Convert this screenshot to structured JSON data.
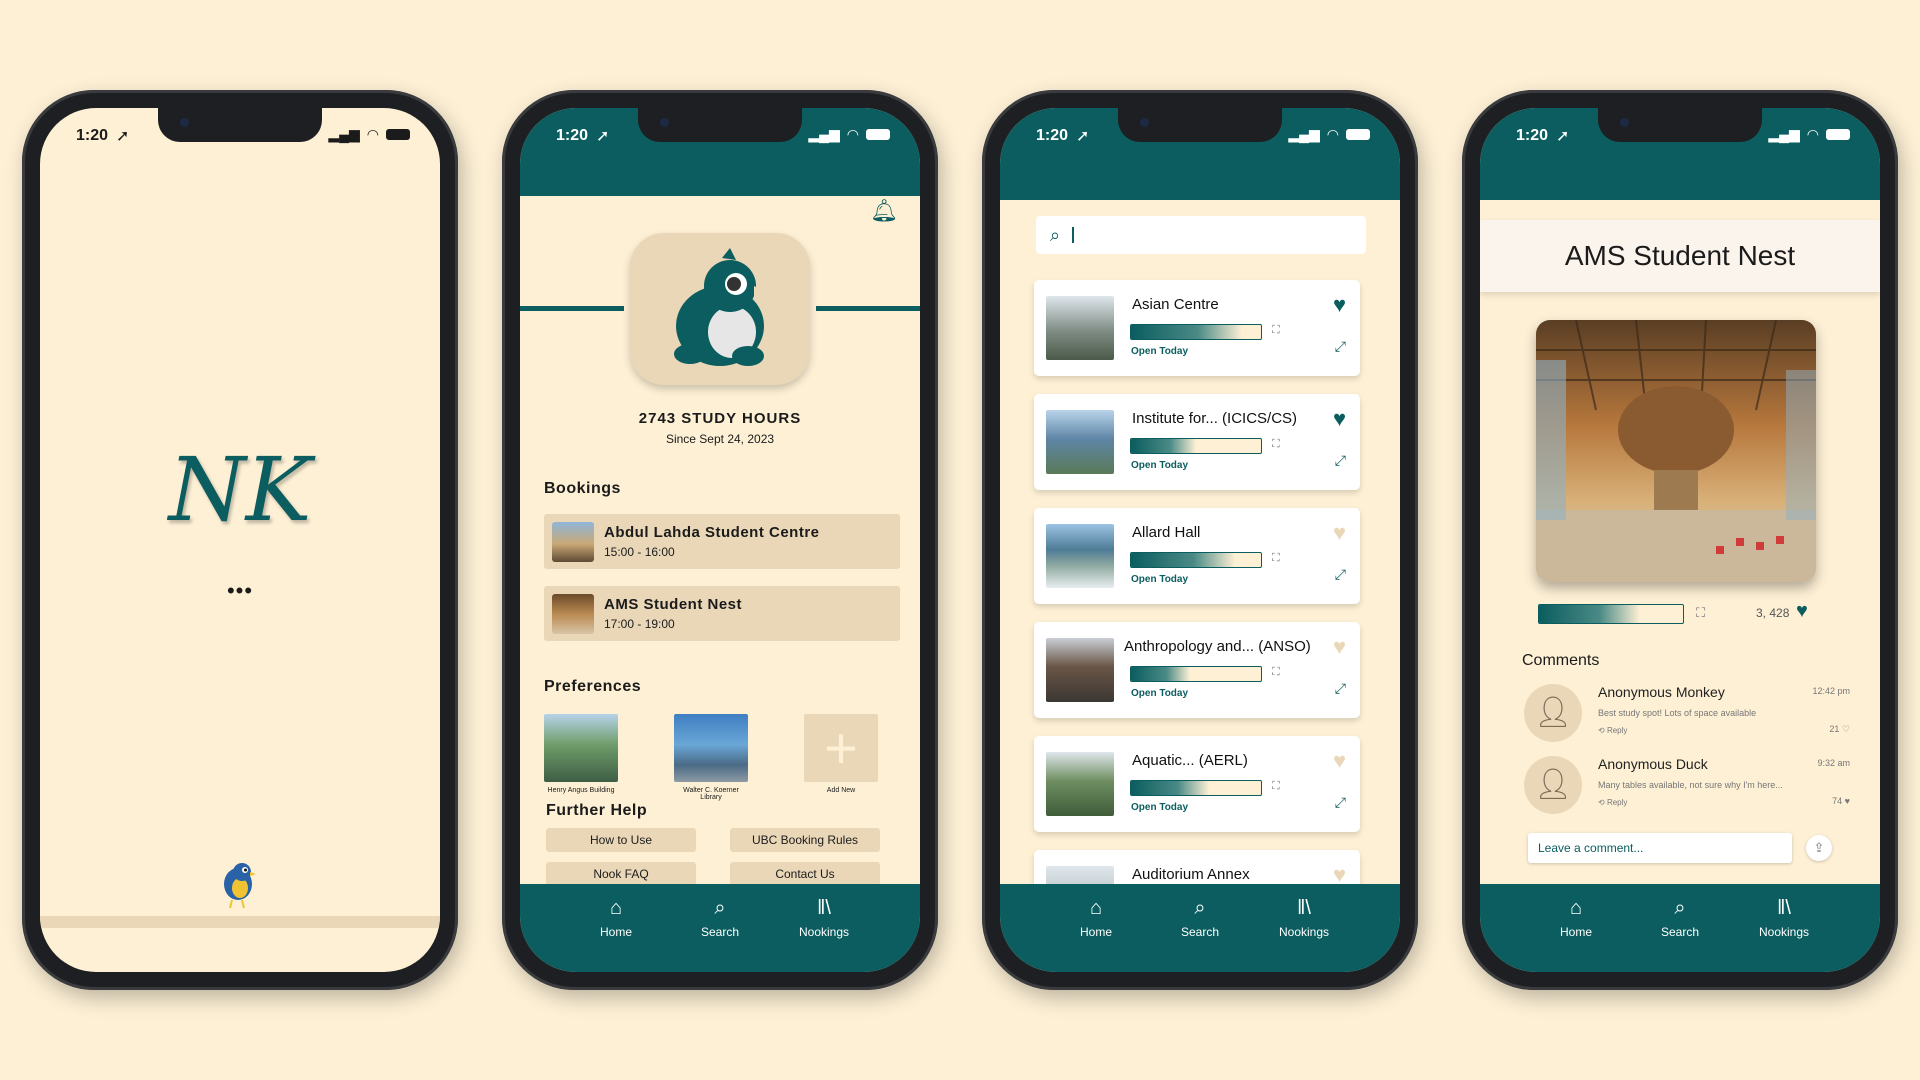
{
  "status": {
    "time": "1:20"
  },
  "nav": {
    "home": "Home",
    "search": "Search",
    "nookings": "Nookings"
  },
  "colors": {
    "teal": "#0b5d5f",
    "cream": "#fdf0d5",
    "tan": "#ead7b8"
  },
  "splash": {
    "logo": "NK",
    "loading": "•••"
  },
  "profile": {
    "study_hours": "2743 STUDY HOURS",
    "since": "Since Sept 24, 2023",
    "bookings_title": "Bookings",
    "bookings": [
      {
        "name": "Abdul Lahda Student Centre",
        "time": "15:00 - 16:00"
      },
      {
        "name": "AMS Student Nest",
        "time": "17:00 - 19:00"
      }
    ],
    "preferences_title": "Preferences",
    "preferences": [
      {
        "caption": "Henry Angus Building"
      },
      {
        "caption": "Walter C. Koerner Library"
      },
      {
        "caption": "Add New"
      }
    ],
    "help_title": "Further Help",
    "help": [
      "How to Use",
      "UBC Booking Rules",
      "Nook FAQ",
      "Contact Us"
    ]
  },
  "search": {
    "results": [
      {
        "name": "Asian Centre",
        "status": "Open Today",
        "occupancy": 0.85,
        "favorite": true
      },
      {
        "name": "Institute for... (ICICS/CS)",
        "status": "Open Today",
        "occupancy": 0.5,
        "favorite": true
      },
      {
        "name": "Allard Hall",
        "status": "Open Today",
        "occupancy": 0.8,
        "favorite": false
      },
      {
        "name": "Anthropology and... (ANSO)",
        "status": "Open Today",
        "occupancy": 0.45,
        "favorite": false
      },
      {
        "name": "Aquatic... (AERL)",
        "status": "Open Today",
        "occupancy": 0.6,
        "favorite": false
      },
      {
        "name": "Auditorium Annex",
        "status": "",
        "occupancy": 0,
        "favorite": false
      }
    ]
  },
  "detail": {
    "title": "AMS Student Nest",
    "occupancy": 0.7,
    "likes": "3, 428",
    "comments_title": "Comments",
    "comments": [
      {
        "name": "Anonymous Monkey",
        "time": "12:42 pm",
        "text": "Best study spot! Lots of space available",
        "reply": "Reply",
        "likes": "21"
      },
      {
        "name": "Anonymous Duck",
        "time": "9:32 am",
        "text": "Many tables available, not sure why I'm here...",
        "reply": "Reply",
        "likes": "74"
      }
    ],
    "comment_placeholder": "Leave a comment..."
  }
}
